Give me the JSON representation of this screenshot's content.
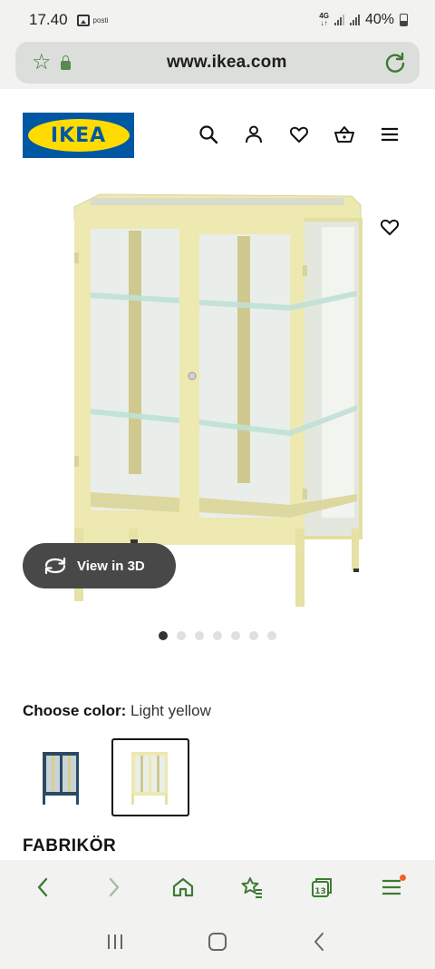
{
  "status_bar": {
    "time": "17.40",
    "notification_label": "posti",
    "network": "4G",
    "battery": "40%"
  },
  "browser": {
    "url": "www.ikea.com"
  },
  "site": {
    "logo_text": "IKEA",
    "header_icons": [
      "search-icon",
      "user-icon",
      "heart-icon",
      "basket-icon",
      "menu-icon"
    ]
  },
  "product": {
    "view_3d_label": "View in 3D",
    "image_count": 7,
    "active_image_index": 0,
    "choose_color_label": "Choose color:",
    "selected_color": "Light yellow",
    "color_options": [
      {
        "name": "Dark blue",
        "hex": "#2b4a63",
        "selected": false
      },
      {
        "name": "Light yellow",
        "hex": "#ede9b0",
        "selected": true
      }
    ],
    "name": "FABRIKÖR"
  },
  "bottom_nav": {
    "tab_count": "13",
    "items": [
      "back-icon",
      "forward-icon",
      "home-icon",
      "bookmarks-icon",
      "tabs-icon",
      "menu-icon"
    ]
  },
  "colors": {
    "ikea_blue": "#0058a3",
    "ikea_yellow": "#ffdb00",
    "browser_accent": "#3e7a34",
    "cabinet_yellow": "#ede9b0"
  }
}
